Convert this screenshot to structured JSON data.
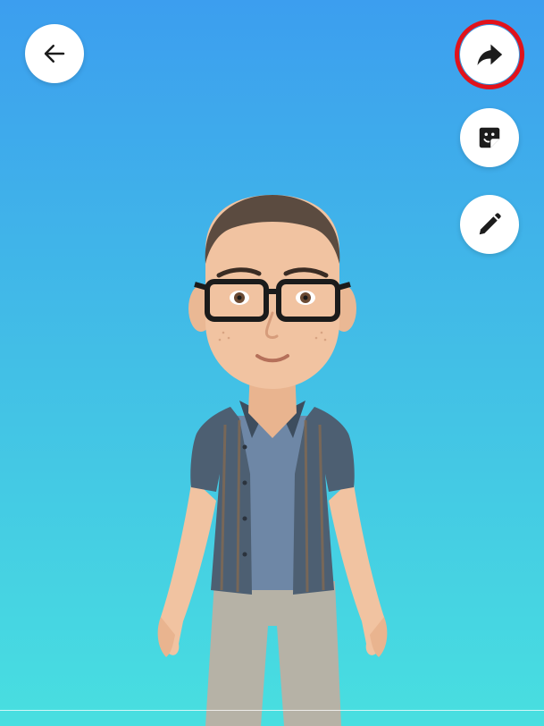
{
  "toolbar": {
    "back": {
      "icon": "arrow-left-icon"
    },
    "share": {
      "icon": "share-arrow-icon",
      "highlighted": true,
      "highlight_color": "#e1121b"
    },
    "sticker": {
      "icon": "sticker-face-icon"
    },
    "edit": {
      "icon": "pencil-icon"
    }
  },
  "background": {
    "gradient_top": "#3c9eef",
    "gradient_bottom": "#48dfe0"
  },
  "avatar": {
    "skin": "#f1c3a1",
    "shirt": "#4d5f72",
    "tshirt": "#6e87a6",
    "pants": "#b6b2a6",
    "glasses": "#1b1b1b",
    "hair": "#5b4b40"
  }
}
